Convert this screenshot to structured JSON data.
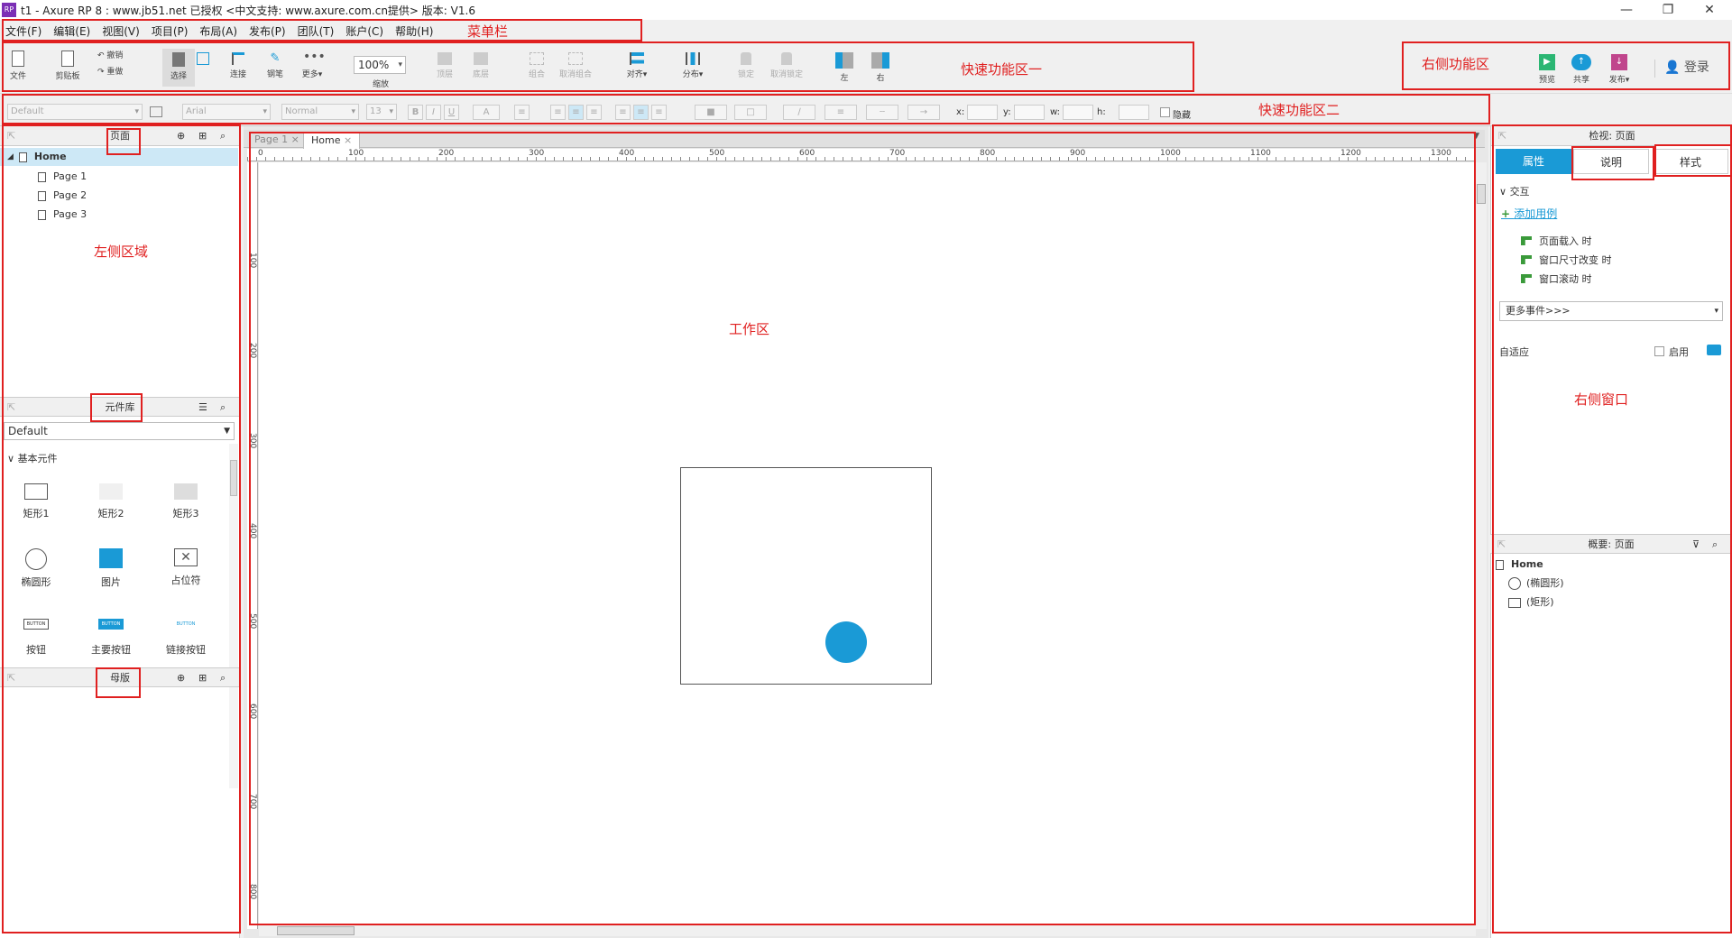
{
  "titlebar": {
    "title": "t1 - Axure RP 8  : www.jb51.net 已授权     <中文支持: www.axure.com.cn提供> 版本: V1.6",
    "logo": "RP"
  },
  "menu": [
    "文件(F)",
    "编辑(E)",
    "视图(V)",
    "项目(P)",
    "布局(A)",
    "发布(P)",
    "团队(T)",
    "账户(C)",
    "帮助(H)"
  ],
  "toolbar1": {
    "file": "文件",
    "clipboard": "剪贴板",
    "undo": "撤销",
    "redo": "重做",
    "select": "选择",
    "connect": "连接",
    "pen": "钢笔",
    "more": "更多▾",
    "zoom_value": "100%",
    "zoom_label": "缩放",
    "top": "顶层",
    "bottom": "底层",
    "group": "组合",
    "ungroup": "取消组合",
    "align": "对齐▾",
    "distribute": "分布▾",
    "lock": "锁定",
    "unlock": "取消锁定",
    "left": "左",
    "right": "右",
    "preview": "预览",
    "share": "共享",
    "publish": "发布▾",
    "login": "登录"
  },
  "toolbar2": {
    "style": "Default",
    "font": "Arial",
    "weight": "Normal",
    "size": "13",
    "x": "x:",
    "y": "y:",
    "w": "w:",
    "h": "h:",
    "hide": "隐藏"
  },
  "left": {
    "pages_title": "页面",
    "pages": [
      "Home",
      "Page 1",
      "Page 2",
      "Page 3"
    ],
    "library_title": "元件库",
    "library_select": "Default",
    "library_group": "基本元件",
    "widgets": [
      "矩形1",
      "矩形2",
      "矩形3",
      "椭圆形",
      "图片",
      "占位符",
      "按钮",
      "主要按钮",
      "链接按钮"
    ],
    "masters_title": "母版",
    "btn_text": "BUTTON"
  },
  "canvas": {
    "tabs": [
      "Page 1",
      "Home"
    ],
    "ruler_h": [
      "0",
      "100",
      "200",
      "300",
      "400",
      "500",
      "600",
      "700",
      "800",
      "900",
      "1000",
      "1100",
      "1200",
      "1300"
    ],
    "ruler_v": [
      "100",
      "200",
      "300",
      "400",
      "500",
      "600",
      "700",
      "800"
    ]
  },
  "right": {
    "inspect_title": "检视: 页面",
    "tabs": [
      "属性",
      "说明",
      "样式"
    ],
    "interaction": "交互",
    "add_case": "添加用例",
    "events": [
      "页面载入 时",
      "窗口尺寸改变 时",
      "窗口滚动 时"
    ],
    "more_events": "更多事件>>>",
    "adaptive": "自适应",
    "enable": "启用",
    "outline_title": "概要: 页面",
    "outline": [
      "Home",
      "(椭圆形)",
      "(矩形)"
    ]
  },
  "annotations": {
    "menubar": "菜单栏",
    "quick1": "快速功能区一",
    "quick2": "快速功能区二",
    "right_func": "右侧功能区",
    "left_area": "左侧区域",
    "work_area": "工作区",
    "right_window": "右侧窗口"
  },
  "colors": {
    "accent": "#1a9ad6",
    "annotation": "#e02020",
    "ellipse": "#1a9ad6"
  }
}
